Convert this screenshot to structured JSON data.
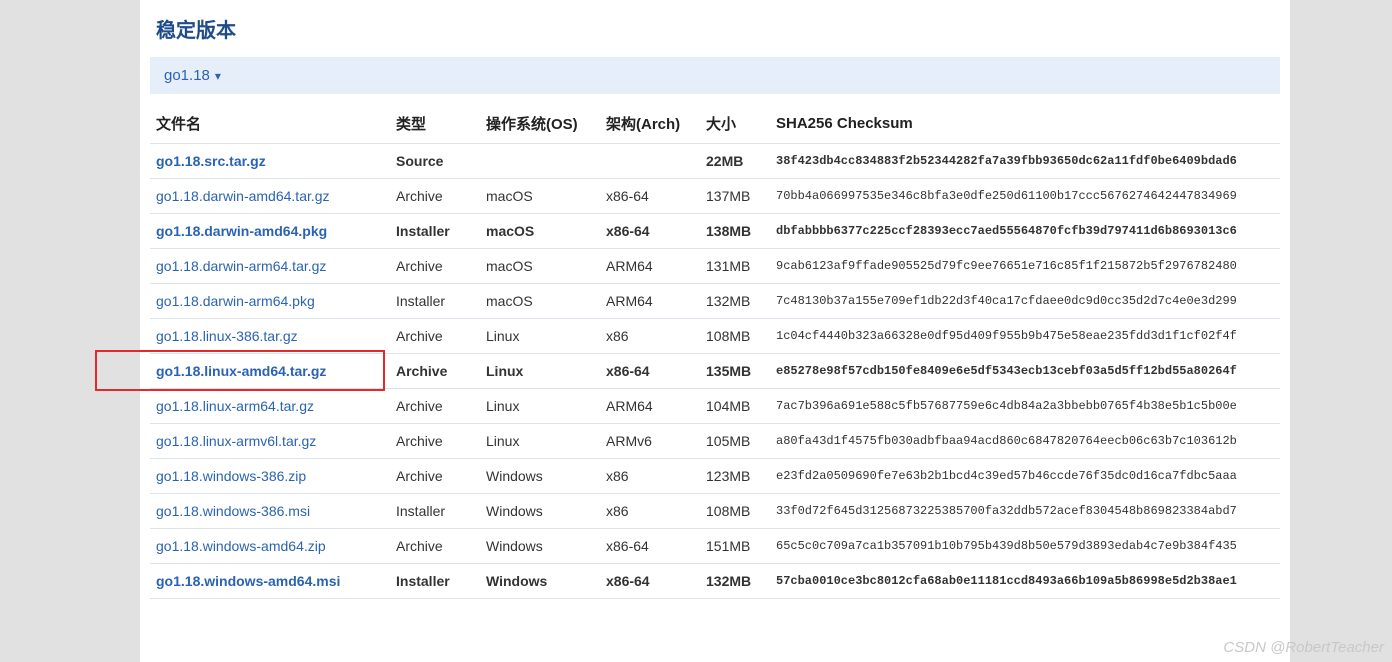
{
  "section_title": "稳定版本",
  "version": "go1.18",
  "columns": {
    "file": "文件名",
    "type": "类型",
    "os": "操作系统(OS)",
    "arch": "架构(Arch)",
    "size": "大小",
    "sha": "SHA256 Checksum"
  },
  "rows": [
    {
      "file": "go1.18.src.tar.gz",
      "type": "Source",
      "os": "",
      "arch": "",
      "size": "22MB",
      "sha": "38f423db4cc834883f2b52344282fa7a39fbb93650dc62a11fdf0be6409bdad6",
      "bold": true
    },
    {
      "file": "go1.18.darwin-amd64.tar.gz",
      "type": "Archive",
      "os": "macOS",
      "arch": "x86-64",
      "size": "137MB",
      "sha": "70bb4a066997535e346c8bfa3e0dfe250d61100b17ccc5676274642447834969",
      "bold": false
    },
    {
      "file": "go1.18.darwin-amd64.pkg",
      "type": "Installer",
      "os": "macOS",
      "arch": "x86-64",
      "size": "138MB",
      "sha": "dbfabbbb6377c225ccf28393ecc7aed55564870fcfb39d797411d6b8693013c6",
      "bold": true
    },
    {
      "file": "go1.18.darwin-arm64.tar.gz",
      "type": "Archive",
      "os": "macOS",
      "arch": "ARM64",
      "size": "131MB",
      "sha": "9cab6123af9ffade905525d79fc9ee76651e716c85f1f215872b5f2976782480",
      "bold": false
    },
    {
      "file": "go1.18.darwin-arm64.pkg",
      "type": "Installer",
      "os": "macOS",
      "arch": "ARM64",
      "size": "132MB",
      "sha": "7c48130b37a155e709ef1db22d3f40ca17cfdaee0dc9d0cc35d2d7c4e0e3d299",
      "bold": false
    },
    {
      "file": "go1.18.linux-386.tar.gz",
      "type": "Archive",
      "os": "Linux",
      "arch": "x86",
      "size": "108MB",
      "sha": "1c04cf4440b323a66328e0df95d409f955b9b475e58eae235fdd3d1f1cf02f4f",
      "bold": false
    },
    {
      "file": "go1.18.linux-amd64.tar.gz",
      "type": "Archive",
      "os": "Linux",
      "arch": "x86-64",
      "size": "135MB",
      "sha": "e85278e98f57cdb150fe8409e6e5df5343ecb13cebf03a5d5ff12bd55a80264f",
      "bold": true,
      "highlight": true
    },
    {
      "file": "go1.18.linux-arm64.tar.gz",
      "type": "Archive",
      "os": "Linux",
      "arch": "ARM64",
      "size": "104MB",
      "sha": "7ac7b396a691e588c5fb57687759e6c4db84a2a3bbebb0765f4b38e5b1c5b00e",
      "bold": false
    },
    {
      "file": "go1.18.linux-armv6l.tar.gz",
      "type": "Archive",
      "os": "Linux",
      "arch": "ARMv6",
      "size": "105MB",
      "sha": "a80fa43d1f4575fb030adbfbaa94acd860c6847820764eecb06c63b7c103612b",
      "bold": false
    },
    {
      "file": "go1.18.windows-386.zip",
      "type": "Archive",
      "os": "Windows",
      "arch": "x86",
      "size": "123MB",
      "sha": "e23fd2a0509690fe7e63b2b1bcd4c39ed57b46ccde76f35dc0d16ca7fdbc5aaa",
      "bold": false
    },
    {
      "file": "go1.18.windows-386.msi",
      "type": "Installer",
      "os": "Windows",
      "arch": "x86",
      "size": "108MB",
      "sha": "33f0d72f645d31256873225385700fa32ddb572acef8304548b869823384abd7",
      "bold": false
    },
    {
      "file": "go1.18.windows-amd64.zip",
      "type": "Archive",
      "os": "Windows",
      "arch": "x86-64",
      "size": "151MB",
      "sha": "65c5c0c709a7ca1b357091b10b795b439d8b50e579d3893edab4c7e9b384f435",
      "bold": false
    },
    {
      "file": "go1.18.windows-amd64.msi",
      "type": "Installer",
      "os": "Windows",
      "arch": "x86-64",
      "size": "132MB",
      "sha": "57cba0010ce3bc8012cfa68ab0e11181ccd8493a66b109a5b86998e5d2b38ae1",
      "bold": true
    }
  ],
  "watermark": "CSDN @RobertTeacher"
}
